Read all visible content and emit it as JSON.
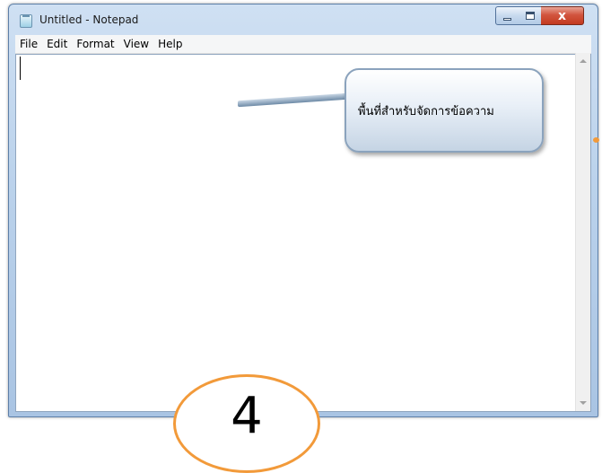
{
  "window": {
    "title": "Untitled - Notepad",
    "icon": "notepad-icon",
    "controls": {
      "minimize_icon": "minimize-icon",
      "maximize_icon": "maximize-icon",
      "close_glyph": "x"
    }
  },
  "menu": [
    "File",
    "Edit",
    "Format",
    "View",
    "Help"
  ],
  "editor": {
    "content": ""
  },
  "callout": {
    "text": "พื้นที่สำหรับจัดการข้อความ"
  },
  "step_badge": {
    "number": "4"
  },
  "colors": {
    "accent_orange": "#f29a3a",
    "close_red": "#c33a20",
    "frame_blue": "#bcd3ec"
  }
}
